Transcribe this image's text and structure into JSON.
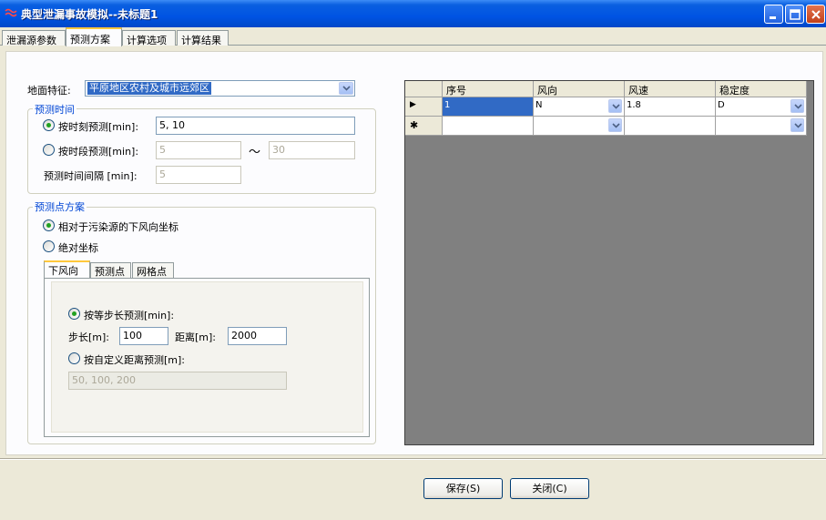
{
  "window": {
    "title": "典型泄漏事故模拟--未标题1"
  },
  "main_tabs": [
    {
      "label": "泄漏源参数",
      "active": false
    },
    {
      "label": "预测方案",
      "active": true
    },
    {
      "label": "计算选项",
      "active": false
    },
    {
      "label": "计算结果",
      "active": false
    }
  ],
  "surface": {
    "label": "地面特征:",
    "selected": "平原地区农村及城市远郊区"
  },
  "time_group": {
    "title": "预测时间",
    "moment": {
      "label": "按时刻预测[min]:",
      "value": "5, 10",
      "checked": true
    },
    "period": {
      "label": "按时段预测[min]:",
      "from": "5",
      "to": "30",
      "separator": "～",
      "checked": false
    },
    "interval": {
      "label": "预测时间间隔 [min]:",
      "value": "5"
    }
  },
  "points_group": {
    "title": "预测点方案",
    "relative": {
      "label": "相对于污染源的下风向坐标",
      "checked": true
    },
    "absolute": {
      "label": "绝对坐标",
      "checked": false
    },
    "subtabs": [
      {
        "label": "下风向",
        "active": true
      },
      {
        "label": "预测点",
        "active": false
      },
      {
        "label": "网格点",
        "active": false
      }
    ],
    "equal_step": {
      "label": "按等步长预测[min]:",
      "checked": true
    },
    "step": {
      "label": "步长[m]:",
      "value": "100"
    },
    "distance": {
      "label": "距离[m]:",
      "value": "2000"
    },
    "custom": {
      "label": "按自定义距离预测[m]:",
      "checked": false,
      "value": "50, 100, 200"
    }
  },
  "grid": {
    "columns": [
      "序号",
      "风向",
      "风速",
      "稳定度"
    ],
    "rows": [
      {
        "marker": "▶",
        "cells": [
          "1",
          "N",
          "1.8",
          "D"
        ]
      },
      {
        "marker": "✱",
        "cells": [
          "",
          "",
          "",
          ""
        ]
      }
    ]
  },
  "buttons": {
    "save": "保存(S)",
    "close": "关闭(C)"
  },
  "colors": {
    "titlebar": "#0054e3",
    "selection": "#316ac5",
    "group_title": "#0046d5",
    "grid_background": "#808080"
  }
}
